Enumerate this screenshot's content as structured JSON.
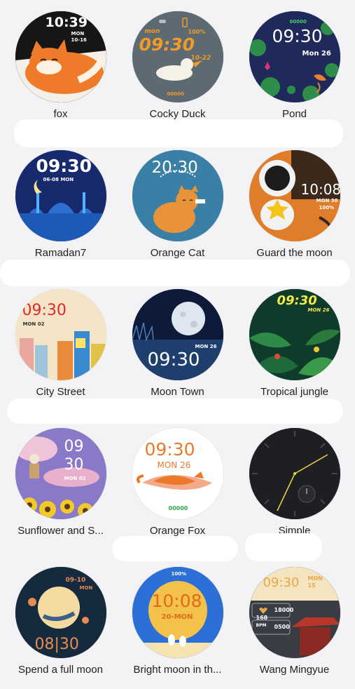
{
  "watch_faces": [
    {
      "name": "fox",
      "time": "10:39",
      "date1": "MON",
      "date2": "10-16",
      "bg": "#1b1b1b",
      "accent": "#f07a28"
    },
    {
      "name": "Cocky Duck",
      "time": "09:30",
      "date1": "mon",
      "date2": "10-22",
      "battery": "100%",
      "steps": "00000",
      "bg": "#5d6a72",
      "accent": "#ef9a2a"
    },
    {
      "name": "Pond",
      "time": "09:30",
      "date1": "Mon 26",
      "steps": "00000",
      "bg": "#1f2a5b",
      "accent": "#e0336f"
    },
    {
      "name": "Ramadan7",
      "time": "09:30",
      "date1": "06-08  MON",
      "bg": "#182a6e",
      "accent": "#3f8fdf"
    },
    {
      "name": "Orange Cat",
      "time": "20:30",
      "bg": "#3a7fa6",
      "accent": "#e8933a"
    },
    {
      "name": "Guard the moon",
      "time": "10:08",
      "date1": "MON 30",
      "battery": "100%",
      "bg": "#e07d2b",
      "accent": "#f4c41a"
    },
    {
      "name": "City Street",
      "time": "09:30",
      "date1": "MON 02",
      "bg": "#f3e4c8",
      "accent": "#e02a2a"
    },
    {
      "name": "Moon Town",
      "time": "09:30",
      "date1": "MON 26",
      "bg": "#0d1a3a",
      "accent": "#dfe6f0"
    },
    {
      "name": "Tropical jungle",
      "time": "09:30",
      "date1": "MON 26",
      "bg": "#0f3b2a",
      "accent": "#f2e94a"
    },
    {
      "name": "Sunflower and S...",
      "time_h": "09",
      "time_m": "30",
      "date1": "MON 02",
      "bg": "#8a78c8",
      "accent": "#f2c92a"
    },
    {
      "name": "Orange Fox",
      "time": "09:30",
      "date1": "MON 26",
      "steps": "00000",
      "bg": "#ffffff",
      "accent": "#ea7a2a"
    },
    {
      "name": "Simple",
      "bg": "#1e1f22",
      "accent": "#e8d93a"
    },
    {
      "name": "Spend a full moon",
      "time": "08|30",
      "date1": "09-10",
      "date2": "MON",
      "bg": "#152a3c",
      "accent": "#e98a52"
    },
    {
      "name": "Bright moon in th...",
      "time": "10:08",
      "date1": "20-MON",
      "battery": "100%",
      "bg": "#2c6fd6",
      "accent": "#f4a93a"
    },
    {
      "name": "Wang Mingyue",
      "time": "09:30",
      "date1": "MON",
      "date2": "15",
      "steps": "18000",
      "bpm_val": "168",
      "bpm_label": "BPM",
      "cal": "0500",
      "bg": "#3a3c44",
      "accent": "#e9a74a"
    }
  ]
}
